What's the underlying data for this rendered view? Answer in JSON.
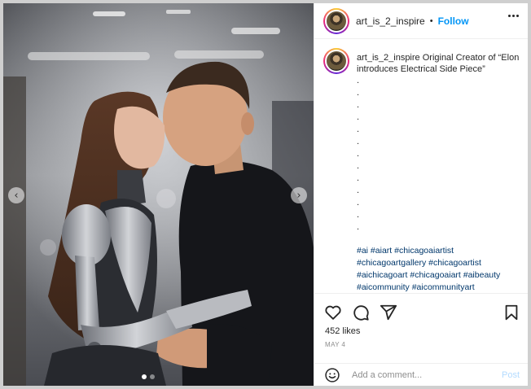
{
  "post": {
    "username": "art_is_2_inspire",
    "separator": "•",
    "follow_label": "Follow",
    "more_icon": "more-horizontal-icon"
  },
  "caption": {
    "username": "art_is_2_inspire",
    "text": "Original Creator of “Elon introduces Electrical Side Piece”",
    "dots": [
      ".",
      ".",
      ".",
      ".",
      ".",
      ".",
      ".",
      ".",
      ".",
      ".",
      ".",
      ".",
      "."
    ],
    "hashtags": "#ai #aiart #chicagoaiartist #chicagoartgallery #chicagoartist #aichicagoart #chicagoaiart #aibeauty #aicommunity #aicommunityart #viralfashion #aiartwork #art #chicago"
  },
  "actions": {
    "like_icon": "heart-icon",
    "comment_icon": "comment-icon",
    "share_icon": "share-icon",
    "save_icon": "bookmark-icon",
    "likes_text": "452 likes",
    "date_text": "MAY 4"
  },
  "comment": {
    "placeholder": "Add a comment...",
    "post_label": "Post",
    "emoji_icon": "emoji-icon"
  },
  "media": {
    "prev_glyph": "‹",
    "next_glyph": "›",
    "slide_count": 2,
    "active_slide": 1
  },
  "colors": {
    "link_blue": "#0095f6",
    "hashtag_blue": "#00376b",
    "muted_gray": "#8e8e8e",
    "post_disabled": "#b3dbff"
  }
}
